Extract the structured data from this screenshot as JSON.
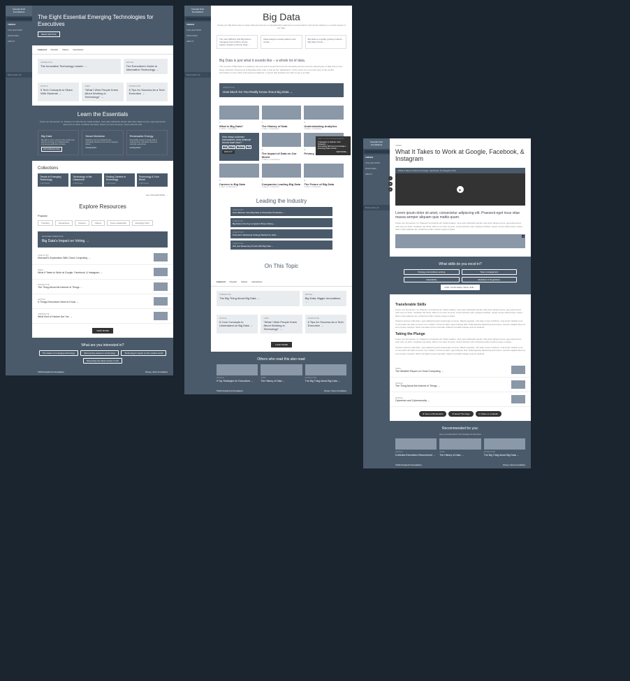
{
  "brand": "Comptia Tech Foundations",
  "nav": {
    "topics": "TOPICS",
    "collections": "COLLECTIONS",
    "discover": "DISCOVER",
    "about": "ABOUT",
    "bookmarks": "Bookmarks (2)",
    "search_icon": "⌕"
  },
  "screen1": {
    "hero": {
      "title": "The Eight Essential Emerging Technologies for Executives",
      "btn": "READ ARTICLE"
    },
    "tabs": [
      "Featured",
      "Popular",
      "Videos",
      "Interactives"
    ],
    "featured": [
      {
        "tag": "INTERACTIVE",
        "title": "The Innovative Technology Leader →"
      },
      {
        "tag": "ARTICLE",
        "title": "The Executive's Guide to Information Technology →"
      }
    ],
    "row2": [
      {
        "tag": "ARTICLE",
        "title": "5 Tech Concepts to Share With Students →"
      },
      {
        "tag": "VIDEO",
        "title": "\"What I Wish People Knew About Working in Technology\" →"
      },
      {
        "tag": "INTERACTIVE",
        "title": "6 Tips for Success As a Tech Executive →"
      }
    ],
    "essentials": {
      "title": "Learn the Essentials",
      "sub": "Fusce non fermentum mi. Praesent vel lobortis elit. Nulla sodales, risus quis sollicitudin iaculis, felis dolor aliquet purus, eget elementum velit nunc eu dolor. Curabitur ate tellus, dictum non arcu sit amet, viverra lobortis velit.",
      "cards": [
        {
          "title": "Big Data",
          "desc": "Big data is a term used to refer to data sets that are too large for traditional data-processing application software.",
          "btn": "EXPLORE BIG DATA"
        },
        {
          "title": "Smart Medicine",
          "desc": "Medicines can be programmed to specifically attempt a cure for the targeted patient.",
          "btn": "Coming Soon!"
        },
        {
          "title": "Renewable Energy",
          "desc": "Renewable energy is energy that is collected from renewable resources naturally replenished.",
          "btn": "Coming Soon!"
        }
      ]
    },
    "collections": {
      "title": "Collections",
      "items": [
        {
          "title": "Trends in Emerging Technology",
          "meta": "4 ARTICLES"
        },
        {
          "title": "Technology in the Classroom",
          "meta": "3 ARTICLES"
        },
        {
          "title": "Finding Careers in Technology",
          "meta": "5 ARTICLES"
        },
        {
          "title": "Technology & Your World",
          "meta": "4 ARTICLES"
        }
      ],
      "all": "ALL COLLECTIONS →"
    },
    "explore": {
      "title": "Explore Resources",
      "sub": "Popular",
      "tags": [
        "Trending",
        "Interactives",
        "Careers",
        "Videos",
        "Team Leadership",
        "Emerging Tech"
      ],
      "featured": {
        "tag": "FEATURED INTERACTIVE",
        "title": "Big Data's Impact on Voting →"
      },
      "items": [
        {
          "tag": "CASE STUDY",
          "title": "Microsoft's Exploration With Cloud Computing →"
        },
        {
          "tag": "VIDEO",
          "title": "What It Takes to Work at Google, Facebook, & Instagram →"
        },
        {
          "tag": "INTERACTIVE",
          "title": "The Thing About the Internet of Things →"
        },
        {
          "tag": "ARTICLE",
          "title": "5 Things Executives Need to Know →"
        },
        {
          "tag": "INTERACTIVE",
          "title": "What Kind of Hacker Are You →"
        }
      ],
      "more": "VIEW MORE"
    },
    "interested": {
      "title": "What are you interested in?",
      "pills": [
        "The basics of emerging technology",
        "Discovering careers in technology",
        "Technology's impact on the modern world",
        "Discussing the latest trends in tech"
      ]
    },
    "footer": {
      "copy": "©2018 Comptia Tech Foundations",
      "links": "Privacy  |  Terms & Conditions"
    }
  },
  "screen2": {
    "hero": {
      "title": "Big Data",
      "sub": "Simply put, Big Data refers to large data sets that are computationally analyzed to reveal patterns and trends relating to a certain aspect of the data."
    },
    "boxes": [
      "The main difficulty with Big Data is managing how it will be stored.\n\nApple's Insight on Phone Data →",
      "Data analysis reveals patterns and trends.\n\n",
      "Big Data is a rapidly growing industry.\n\nBig Data Trends →"
    ],
    "intro": {
      "h": "Big Data is just what it sounds like – a whole lot of data.",
      "p": "The concept of Big Data is a relatively new one and it represents both the increasing amount and the varied types of data that is now being collected. Proponents of Big Data often refer to this as the \"datafication\" of the world. As more and more of the world's information moves online and becomes digitized, it means that analysts can start to use it as data."
    },
    "cta": {
      "tag": "INTERACTIVE",
      "title": "How Much Do You Really Know About Big Data →"
    },
    "grid": [
      {
        "num": "1",
        "title": "What is Big Data?",
        "meta": "2 videos • 1 interactive"
      },
      {
        "num": "2",
        "title": "The History of Data",
        "meta": "1 video • 2 interactives"
      },
      {
        "num": "3",
        "title": "Understanding Analytics",
        "meta": "2 videos • 1 interactive"
      },
      {
        "num": "4",
        "title": "The Impact of Data on Our World",
        "meta": "2 videos • 2 interactives"
      },
      {
        "num": "5",
        "title": "Privacy, Security,",
        "meta": ""
      },
      {
        "num": "6",
        "title": "Careers in Big Data",
        "meta": "1 video • 2 interactives"
      },
      {
        "num": "7",
        "title": "Companies Leading Big Data",
        "meta": "2 videos • 1 interactive"
      },
      {
        "num": "8",
        "title": "The Future of Big Data",
        "meta": "1 video • 1 interactive"
      }
    ],
    "quiz": {
      "q": "How many customer transactions does Walmart record each hour?",
      "opts": [
        "100",
        "1,000",
        "100,000",
        "1M"
      ],
      "btn": "FIND OUT"
    },
    "tooltip": {
      "h": "WHAT TOP EXECUTIVES ARE READING",
      "items": [
        "5 Strategies to Optimize Tech Strategies →",
        "Succeeding With New Technologies →",
        "Executing Sales Growth →"
      ],
      "more": "VIEW MORE →"
    },
    "leading": {
      "title": "Leading the Industry",
      "items": [
        {
          "tag": "CASE STUDY",
          "title": "How Walmart Uses Big Data to Streamline Production →"
        },
        {
          "tag": "CASE STUDY",
          "title": "Big Data is the Key to Apple's Phone Sizing →"
        },
        {
          "tag": "CASE STUDY",
          "title": "Petsmart's Marketing Strategy Backed by Data →"
        },
        {
          "tag": "CASE STUDY",
          "title": "IDC and Measuring Trends With Big Data →"
        }
      ]
    },
    "topic": {
      "title": "On This Topic",
      "tabs": [
        "Featured",
        "Popular",
        "Videos",
        "Interactives"
      ],
      "featured": [
        {
          "tag": "INTERACTIVE",
          "title": "The Big Thing About Big Data →"
        },
        {
          "tag": "ARTICLE",
          "title": "Big Data, Bigger Innovations →"
        }
      ],
      "row2": [
        {
          "tag": "ARTICLE",
          "title": "5 Core Concepts to Understand on Big Data →"
        },
        {
          "tag": "VIDEO",
          "title": "\"What I Wish People Knew About Working in Technology\" →"
        },
        {
          "tag": "INTERACTIVE",
          "title": "6 Tips for Success As a Tech Executive →"
        }
      ],
      "more": "LOAD MORE"
    },
    "also": {
      "title": "Others who read this also read:",
      "items": [
        {
          "tag": "ARTICLE",
          "title": "5 Top Strategies for Executives →"
        },
        {
          "tag": "TOPIC",
          "title": "The History of Data →"
        },
        {
          "tag": "INTERACTIVE",
          "title": "The Big Thing About Big Data →"
        }
      ]
    }
  },
  "screen3": {
    "tag": "VIDEO",
    "title": "What It Takes to Work at Google, Facebook, & Instagram",
    "video_bar": "What It Takes to Work at Google, Facebook, & Instagram\n5:20",
    "play": "▶",
    "social": [
      "f",
      "✉",
      "in"
    ],
    "intro": "Lorem ipsum dolor sit amet, consectetur adipiscing elit. Praesent eget risus vitae massa semper aliquam quis mattis quam.",
    "para": "Fusce non fermentum mi. Praesent vel lobortis elit. Nulla sodales, risus quis sollicitudin iaculis, felis dolor aliquet purus, eget elementum velit nunc eu dolor. Curabitur ate tellus, dictum non arcu sit amet, viverra lobortis velit. Quisque facilisis, neque cursus ullamcorper ornare, dolor metus aliquam leo, pharetra portitor massa neque ut ligula.",
    "skills": {
      "title": "What skills do you excel in?",
      "items": [
        "Strategy and problem-solving",
        "Team management",
        "Adaptability",
        "Mediation & Negotiation"
      ],
      "btn": "FIND YOUR IDEAL TECH JOB →"
    },
    "h1": "Transferable Skills",
    "p1a": "Fusce non fermentum mi. Praesent vel lobortis elit. Nulla sodales, risus quis sollicitudin iaculis, felis dolor aliquet purus, eget elementum velit nunc eu dolor. Curabitur ate tellus, dictum non arcu sit amet, viverra lobortis velit. Quisque facilisis, neque cursus ullamcorper ornare, dolor metus aliquam leo, pharetra portitor massa neque ut ligula.",
    "p1b": "Vivamus laoreet nulla diam, eget adipiscing felis scelerisque sit amet. Mauris egestas, mhi vitae cursus tincidunt, urna ipsum facilisis eros, ut venenatis dui tellus sit amet orci. Nullam a rhoncus diam, eget tristique felis. Nulla agestas adipiscing fermentum. Aenean sagittis libero at eros ornare molestie. Morbi convallis ornare imperdiet. Mauris convallis tristique erat ac eleifend.",
    "h2": "Taking the Plunge",
    "p2a": "Fusce non fermentum mi. Praesent vel lobortis elit. Nulla sodales, risus quis sollicitudin iaculis, felis dolor aliquet purus, eget elementum velit nunc eu dolor. Curabitur ate tellus, dictum non arcu sit amet, viverra lobortis velit, pharetra portitor massa neque ut ligula.",
    "p2b": "Vivamus laoreet nulla diam, eget adipiscing felis scelerisque sit amet. Mauris egestas, mhi vitae cursus tincidunt, urna ipsum facilisis eros, ut venenatis dui tellus sit amet orci. Nullam a rhoncus diam, eget tristique felis. Nulla agestas adipiscing fermentum. Aenean sagittis libero at eros ornare molestie. Morbi convallis ornare imperdiet. Mauris convallis tristique erat ac eleifend.",
    "related": [
      {
        "tag": "VIDEO",
        "title": "The Weather Report on Cloud Computing →"
      },
      {
        "tag": "ARTICLE",
        "title": "The Thing About the Internet of Things →"
      },
      {
        "tag": "ARTICLE",
        "title": "Cyberbots and Cybersecurity →"
      }
    ],
    "actions": [
      "★ Save to Bookmarks",
      "✉ Email This Page",
      "in Share on LinkedIn"
    ],
    "rec": {
      "title": "Recommended for you:",
      "sub": "since you bookmarked 6 Top Strategies for Executives",
      "items": [
        {
          "tag": "ARTICLE",
          "title": "5 Articles Executives Recommend →"
        },
        {
          "tag": "TOPIC",
          "title": "The History of Data →"
        },
        {
          "tag": "INTERACTIVE",
          "title": "The Big Thing About Big Data →"
        }
      ]
    }
  }
}
